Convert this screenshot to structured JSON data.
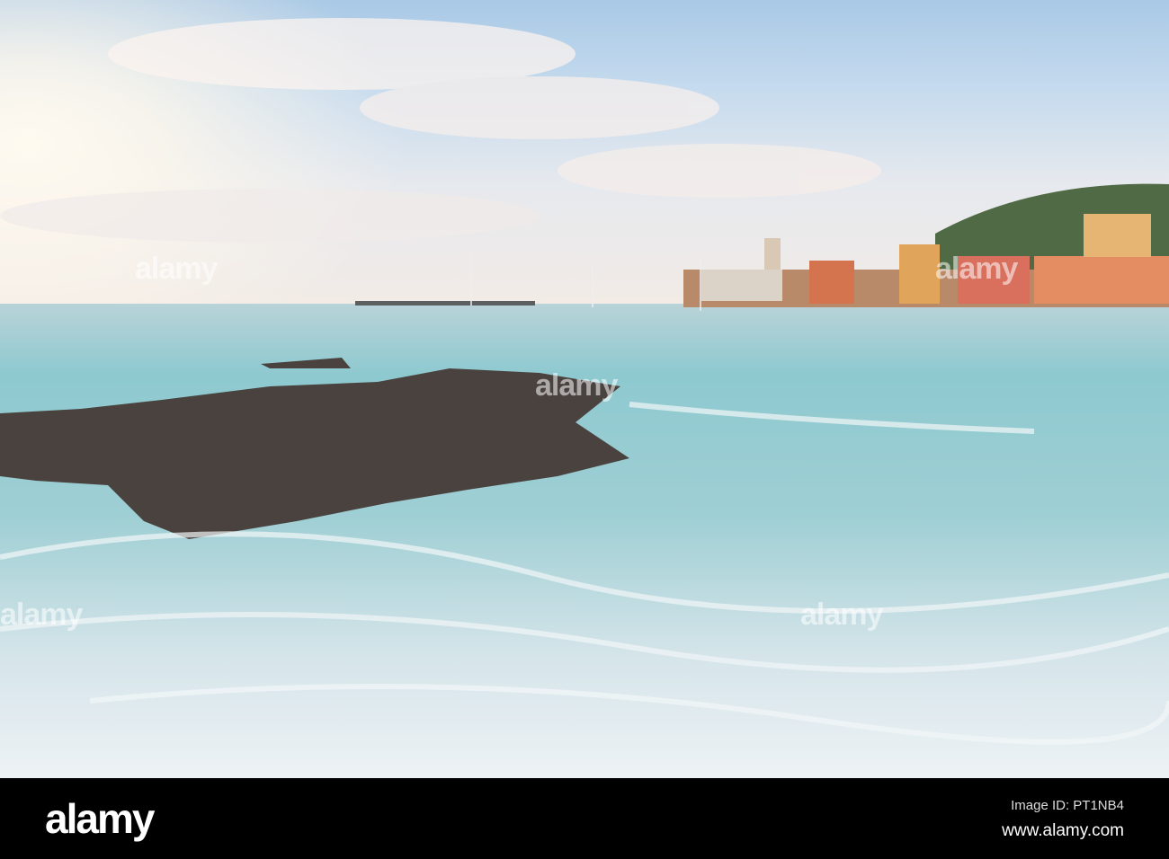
{
  "photo": {
    "alt": "Waves over rocks in a bay with a colorful coastal village at sunrise"
  },
  "watermark": {
    "text": "alamy"
  },
  "footer": {
    "logo": "alamy",
    "image_id": "Image ID: PT1NB4",
    "url": "www.alamy.com"
  }
}
